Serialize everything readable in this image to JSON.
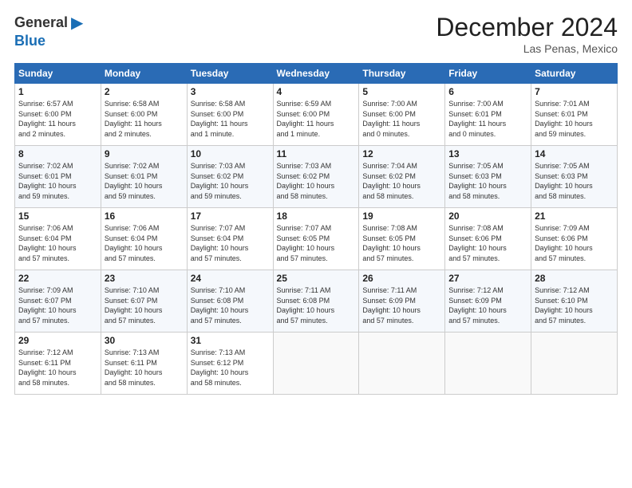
{
  "logo": {
    "general": "General",
    "blue": "Blue",
    "tagline": ""
  },
  "header": {
    "title": "December 2024",
    "location": "Las Penas, Mexico"
  },
  "weekdays": [
    "Sunday",
    "Monday",
    "Tuesday",
    "Wednesday",
    "Thursday",
    "Friday",
    "Saturday"
  ],
  "weeks": [
    [
      {
        "day": "1",
        "lines": [
          "Sunrise: 6:57 AM",
          "Sunset: 6:00 PM",
          "Daylight: 11 hours",
          "and 2 minutes."
        ]
      },
      {
        "day": "2",
        "lines": [
          "Sunrise: 6:58 AM",
          "Sunset: 6:00 PM",
          "Daylight: 11 hours",
          "and 2 minutes."
        ]
      },
      {
        "day": "3",
        "lines": [
          "Sunrise: 6:58 AM",
          "Sunset: 6:00 PM",
          "Daylight: 11 hours",
          "and 1 minute."
        ]
      },
      {
        "day": "4",
        "lines": [
          "Sunrise: 6:59 AM",
          "Sunset: 6:00 PM",
          "Daylight: 11 hours",
          "and 1 minute."
        ]
      },
      {
        "day": "5",
        "lines": [
          "Sunrise: 7:00 AM",
          "Sunset: 6:00 PM",
          "Daylight: 11 hours",
          "and 0 minutes."
        ]
      },
      {
        "day": "6",
        "lines": [
          "Sunrise: 7:00 AM",
          "Sunset: 6:01 PM",
          "Daylight: 11 hours",
          "and 0 minutes."
        ]
      },
      {
        "day": "7",
        "lines": [
          "Sunrise: 7:01 AM",
          "Sunset: 6:01 PM",
          "Daylight: 10 hours",
          "and 59 minutes."
        ]
      }
    ],
    [
      {
        "day": "8",
        "lines": [
          "Sunrise: 7:02 AM",
          "Sunset: 6:01 PM",
          "Daylight: 10 hours",
          "and 59 minutes."
        ]
      },
      {
        "day": "9",
        "lines": [
          "Sunrise: 7:02 AM",
          "Sunset: 6:01 PM",
          "Daylight: 10 hours",
          "and 59 minutes."
        ]
      },
      {
        "day": "10",
        "lines": [
          "Sunrise: 7:03 AM",
          "Sunset: 6:02 PM",
          "Daylight: 10 hours",
          "and 59 minutes."
        ]
      },
      {
        "day": "11",
        "lines": [
          "Sunrise: 7:03 AM",
          "Sunset: 6:02 PM",
          "Daylight: 10 hours",
          "and 58 minutes."
        ]
      },
      {
        "day": "12",
        "lines": [
          "Sunrise: 7:04 AM",
          "Sunset: 6:02 PM",
          "Daylight: 10 hours",
          "and 58 minutes."
        ]
      },
      {
        "day": "13",
        "lines": [
          "Sunrise: 7:05 AM",
          "Sunset: 6:03 PM",
          "Daylight: 10 hours",
          "and 58 minutes."
        ]
      },
      {
        "day": "14",
        "lines": [
          "Sunrise: 7:05 AM",
          "Sunset: 6:03 PM",
          "Daylight: 10 hours",
          "and 58 minutes."
        ]
      }
    ],
    [
      {
        "day": "15",
        "lines": [
          "Sunrise: 7:06 AM",
          "Sunset: 6:04 PM",
          "Daylight: 10 hours",
          "and 57 minutes."
        ]
      },
      {
        "day": "16",
        "lines": [
          "Sunrise: 7:06 AM",
          "Sunset: 6:04 PM",
          "Daylight: 10 hours",
          "and 57 minutes."
        ]
      },
      {
        "day": "17",
        "lines": [
          "Sunrise: 7:07 AM",
          "Sunset: 6:04 PM",
          "Daylight: 10 hours",
          "and 57 minutes."
        ]
      },
      {
        "day": "18",
        "lines": [
          "Sunrise: 7:07 AM",
          "Sunset: 6:05 PM",
          "Daylight: 10 hours",
          "and 57 minutes."
        ]
      },
      {
        "day": "19",
        "lines": [
          "Sunrise: 7:08 AM",
          "Sunset: 6:05 PM",
          "Daylight: 10 hours",
          "and 57 minutes."
        ]
      },
      {
        "day": "20",
        "lines": [
          "Sunrise: 7:08 AM",
          "Sunset: 6:06 PM",
          "Daylight: 10 hours",
          "and 57 minutes."
        ]
      },
      {
        "day": "21",
        "lines": [
          "Sunrise: 7:09 AM",
          "Sunset: 6:06 PM",
          "Daylight: 10 hours",
          "and 57 minutes."
        ]
      }
    ],
    [
      {
        "day": "22",
        "lines": [
          "Sunrise: 7:09 AM",
          "Sunset: 6:07 PM",
          "Daylight: 10 hours",
          "and 57 minutes."
        ]
      },
      {
        "day": "23",
        "lines": [
          "Sunrise: 7:10 AM",
          "Sunset: 6:07 PM",
          "Daylight: 10 hours",
          "and 57 minutes."
        ]
      },
      {
        "day": "24",
        "lines": [
          "Sunrise: 7:10 AM",
          "Sunset: 6:08 PM",
          "Daylight: 10 hours",
          "and 57 minutes."
        ]
      },
      {
        "day": "25",
        "lines": [
          "Sunrise: 7:11 AM",
          "Sunset: 6:08 PM",
          "Daylight: 10 hours",
          "and 57 minutes."
        ]
      },
      {
        "day": "26",
        "lines": [
          "Sunrise: 7:11 AM",
          "Sunset: 6:09 PM",
          "Daylight: 10 hours",
          "and 57 minutes."
        ]
      },
      {
        "day": "27",
        "lines": [
          "Sunrise: 7:12 AM",
          "Sunset: 6:09 PM",
          "Daylight: 10 hours",
          "and 57 minutes."
        ]
      },
      {
        "day": "28",
        "lines": [
          "Sunrise: 7:12 AM",
          "Sunset: 6:10 PM",
          "Daylight: 10 hours",
          "and 57 minutes."
        ]
      }
    ],
    [
      {
        "day": "29",
        "lines": [
          "Sunrise: 7:12 AM",
          "Sunset: 6:11 PM",
          "Daylight: 10 hours",
          "and 58 minutes."
        ]
      },
      {
        "day": "30",
        "lines": [
          "Sunrise: 7:13 AM",
          "Sunset: 6:11 PM",
          "Daylight: 10 hours",
          "and 58 minutes."
        ]
      },
      {
        "day": "31",
        "lines": [
          "Sunrise: 7:13 AM",
          "Sunset: 6:12 PM",
          "Daylight: 10 hours",
          "and 58 minutes."
        ]
      },
      {
        "day": "",
        "lines": []
      },
      {
        "day": "",
        "lines": []
      },
      {
        "day": "",
        "lines": []
      },
      {
        "day": "",
        "lines": []
      }
    ]
  ]
}
